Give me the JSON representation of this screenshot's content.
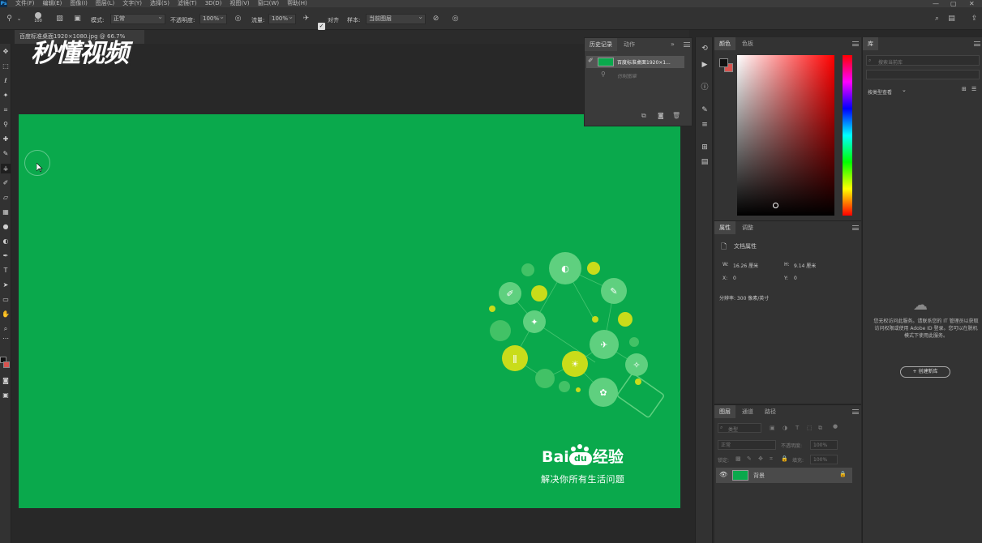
{
  "menu": [
    "文件(F)",
    "编辑(E)",
    "图像(I)",
    "图层(L)",
    "文字(Y)",
    "选择(S)",
    "滤镜(T)",
    "3D(D)",
    "视图(V)",
    "窗口(W)",
    "帮助(H)"
  ],
  "options": {
    "brush_size": "100",
    "mode_label": "模式:",
    "mode_value": "正常",
    "opacity_label": "不透明度:",
    "opacity_value": "100%",
    "flow_label": "流量:",
    "flow_value": "100%",
    "align_label": "对齐",
    "sample_label": "样本:",
    "sample_value": "当前图层"
  },
  "document_tab": "百度标准桌面1920×1080.jpg @ 66.7%",
  "watermark": "秒懂视频",
  "canvas": {
    "brand": "Bai",
    "brand_paw": "du",
    "brand_cn": "经验",
    "slogan": "解决你所有生活问题"
  },
  "history": {
    "tab_history": "历史记录",
    "tab_actions": "动作",
    "items": [
      "百度标准桌面1920×1...",
      "仿制图章"
    ]
  },
  "color": {
    "tab_color": "颜色",
    "tab_swatches": "色板",
    "fg": "#1a1a1a",
    "bg": "#d9534f"
  },
  "properties": {
    "tab_props": "属性",
    "tab_adjust": "调整",
    "doc_props": "文档属性",
    "w_label": "W:",
    "w_value": "16.26 厘米",
    "h_label": "H:",
    "h_value": "9.14 厘米",
    "x_label": "X:",
    "x_value": "0",
    "y_label": "Y:",
    "y_value": "0",
    "resolution": "分辨率: 300 像素/英寸"
  },
  "layers": {
    "tab_layers": "图层",
    "tab_channels": "通道",
    "tab_paths": "路径",
    "kind": "类型",
    "blend": "正常",
    "opacity_label": "不透明度:",
    "opacity_value": "100%",
    "lock_label": "锁定:",
    "fill_label": "填充:",
    "fill_value": "100%",
    "layer_name": "背景"
  },
  "library": {
    "tab": "库",
    "search_placeholder": "搜索当前库",
    "view_by": "按类型查看",
    "message": "您无权访问此服务。请联系您的 IT 管理员以获取访问权限或使用 Adobe ID 登录。您可以在脱机模式下使用此服务。",
    "create_button": "+ 创建新库"
  }
}
